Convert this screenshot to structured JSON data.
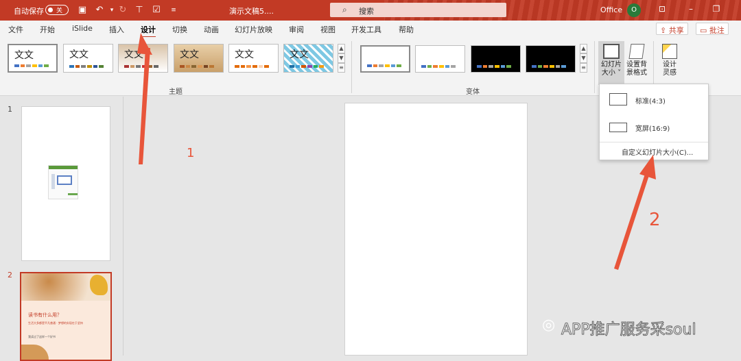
{
  "titlebar": {
    "autosave_label": "自动保存",
    "autosave_state": "关",
    "doc_title": "演示文稿5....",
    "search_placeholder": "搜索",
    "account_label": "Office",
    "avatar_initial": "O",
    "bg_color": "#c23a25"
  },
  "menubar": {
    "tabs": [
      "文件",
      "开始",
      "iSlide",
      "插入",
      "设计",
      "切换",
      "动画",
      "幻灯片放映",
      "审阅",
      "视图",
      "开发工具",
      "帮助"
    ],
    "active_tab": "设计",
    "share_label": "共享",
    "comment_label": "批注"
  },
  "ribbon": {
    "theme_group_label": "主题",
    "variant_group_label": "变体",
    "theme_sample_text": [
      "文文",
      "文文",
      "文文",
      "文文",
      "文文",
      "文文"
    ],
    "slide_size_label_1": "幻灯片",
    "slide_size_label_2": "大小 ˅",
    "format_bg_label_1": "设置背",
    "format_bg_label_2": "景格式",
    "designer_label_1": "设计",
    "designer_label_2": "灵感"
  },
  "slide_size_menu": {
    "standard": "标准(4:3)",
    "widescreen": "宽屏(16:9)",
    "custom": "自定义幻灯片大小(C)..."
  },
  "thumbnails": {
    "slide1_num": "1",
    "slide2_num": "2",
    "slide2_line1": "读书有什么用？",
    "slide2_line2": "生活大多都是平凡普通 · 梦想的实现在于坚持",
    "slide2_line3": "我读过了这样一个好书"
  },
  "annotations": {
    "step1": "1",
    "step2": "2",
    "arrow_color": "#e8553a"
  },
  "watermark": "APP推广服务采soul"
}
